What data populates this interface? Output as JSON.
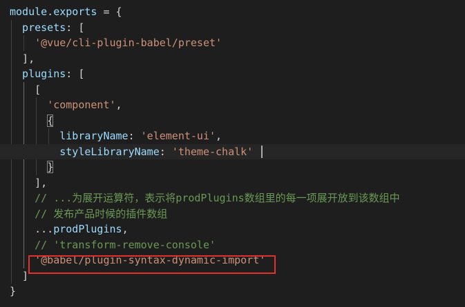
{
  "editor": {
    "language": "javascript",
    "highlight_color": "#e0312d",
    "lines": [
      {
        "id": "l1",
        "tokens": [
          {
            "t": "module.exports",
            "k": "ident"
          },
          {
            "t": " = {",
            "k": "plain"
          }
        ]
      },
      {
        "id": "l2",
        "tokens": [
          {
            "t": "  presets",
            "k": "ident"
          },
          {
            "t": ": [",
            "k": "plain"
          }
        ]
      },
      {
        "id": "l3",
        "tokens": [
          {
            "t": "    ",
            "k": "plain"
          },
          {
            "t": "'@vue/cli-plugin-babel/preset'",
            "k": "string"
          }
        ]
      },
      {
        "id": "l4",
        "tokens": [
          {
            "t": "  ],",
            "k": "plain"
          }
        ]
      },
      {
        "id": "l5",
        "tokens": [
          {
            "t": "  plugins",
            "k": "ident"
          },
          {
            "t": ": [",
            "k": "plain"
          }
        ]
      },
      {
        "id": "l6",
        "tokens": [
          {
            "t": "    [",
            "k": "plain"
          }
        ]
      },
      {
        "id": "l7",
        "tokens": [
          {
            "t": "      ",
            "k": "plain"
          },
          {
            "t": "'component'",
            "k": "string"
          },
          {
            "t": ",",
            "k": "plain"
          }
        ]
      },
      {
        "id": "l8",
        "tokens": [
          {
            "t": "      {",
            "k": "plain"
          }
        ]
      },
      {
        "id": "l9",
        "tokens": [
          {
            "t": "        libraryName",
            "k": "ident"
          },
          {
            "t": ": ",
            "k": "plain"
          },
          {
            "t": "'element-ui'",
            "k": "string"
          },
          {
            "t": ",",
            "k": "plain"
          }
        ]
      },
      {
        "id": "l10",
        "tokens": [
          {
            "t": "        styleLibraryName",
            "k": "ident"
          },
          {
            "t": ": ",
            "k": "plain"
          },
          {
            "t": "'theme-chalk'",
            "k": "string"
          }
        ]
      },
      {
        "id": "l11",
        "tokens": [
          {
            "t": "      }",
            "k": "plain"
          }
        ]
      },
      {
        "id": "l12",
        "tokens": [
          {
            "t": "    ],",
            "k": "plain"
          }
        ]
      },
      {
        "id": "l13",
        "tokens": [
          {
            "t": "    ",
            "k": "plain"
          },
          {
            "t": "// ...为展开运算符，表示将prodPlugins数组里的每一项展开放到该数组中",
            "k": "comment"
          }
        ]
      },
      {
        "id": "l14",
        "tokens": [
          {
            "t": "    ",
            "k": "plain"
          },
          {
            "t": "// 发布产品时候的插件数组",
            "k": "comment"
          }
        ]
      },
      {
        "id": "l15",
        "tokens": [
          {
            "t": "    ...",
            "k": "plain"
          },
          {
            "t": "prodPlugins",
            "k": "ident"
          },
          {
            "t": ",",
            "k": "plain"
          }
        ]
      },
      {
        "id": "l16",
        "tokens": [
          {
            "t": "    ",
            "k": "plain"
          },
          {
            "t": "// 'transform-remove-console'",
            "k": "comment"
          }
        ]
      },
      {
        "id": "l17",
        "tokens": [
          {
            "t": "    ",
            "k": "plain"
          },
          {
            "t": "'@babel/plugin-syntax-dynamic-import'",
            "k": "string"
          }
        ]
      },
      {
        "id": "l18",
        "tokens": [
          {
            "t": "  ]",
            "k": "plain"
          }
        ]
      },
      {
        "id": "l19",
        "tokens": [
          {
            "t": "}",
            "k": "plain"
          }
        ]
      }
    ]
  }
}
